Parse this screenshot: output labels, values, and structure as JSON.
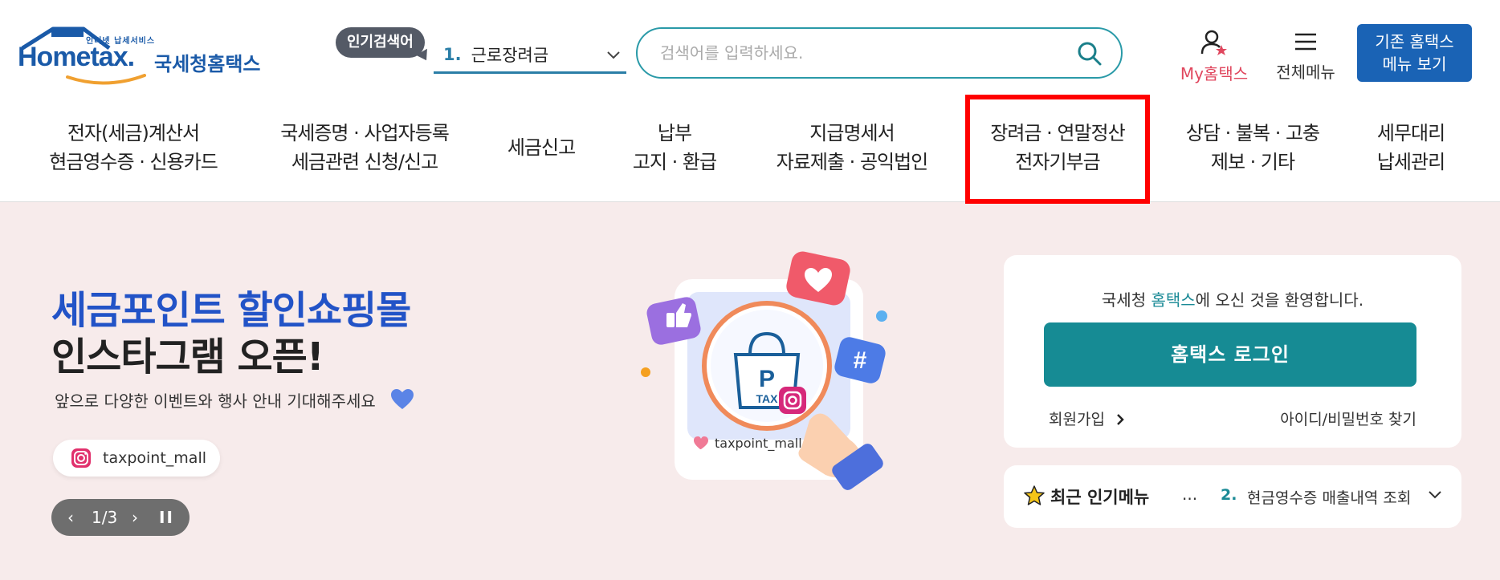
{
  "header": {
    "logo_small": "인터넷 납세서비스",
    "logo_main": "Hometax.",
    "logo_kr": "국세청홈택스",
    "popular_badge": "인기검색어",
    "popular_num": "1.",
    "popular_term": "근로장려금",
    "search_placeholder": "검색어를 입력하세요.",
    "my_label": "My홈택스",
    "allmenu_label": "전체메뉴",
    "old_btn_line1": "기존 홈택스",
    "old_btn_line2": "메뉴 보기"
  },
  "gnb": [
    {
      "l1": "전자(세금)계산서",
      "l2": "현금영수증 · 신용카드"
    },
    {
      "l1": "국세증명 · 사업자등록",
      "l2": "세금관련 신청/신고"
    },
    {
      "l1": "세금신고",
      "l2": ""
    },
    {
      "l1": "납부",
      "l2": "고지 · 환급"
    },
    {
      "l1": "지급명세서",
      "l2": "자료제출 · 공익법인"
    },
    {
      "l1": "장려금 · 연말정산",
      "l2": "전자기부금"
    },
    {
      "l1": "상담 · 불복 · 고충",
      "l2": "제보 · 기타"
    },
    {
      "l1": "세무대리",
      "l2": "납세관리"
    }
  ],
  "hero": {
    "title1": "세금포인트 할인쇼핑몰",
    "title2": "인스타그램 오픈!",
    "subtitle": "앞으로 다양한 이벤트와 행사 안내 기대해주세요",
    "insta_handle": "taxpoint_mall",
    "pager_prev": "‹",
    "pager_page": "1/3",
    "pager_next": "›",
    "pager_pause": "II",
    "illus_handle": "taxpoint_mall",
    "illus_p": "P",
    "illus_tax": "TAX",
    "illus_hash": "#"
  },
  "login": {
    "welcome_pre": "국세청 ",
    "welcome_brand": "홈택스",
    "welcome_post": "에 오신 것을 환영합니다.",
    "login_btn": "홈택스 로그인",
    "join": "회원가입",
    "find": "아이디/비밀번호 찾기"
  },
  "recent": {
    "title": "최근 인기메뉴",
    "dots": "...",
    "num": "2.",
    "item": "현금영수증 매출내역 조회"
  },
  "colors": {
    "brand_blue": "#1a63b5",
    "teal": "#168b94",
    "highlight_red": "#ff0000",
    "hero_bg": "#f7ebeb"
  }
}
